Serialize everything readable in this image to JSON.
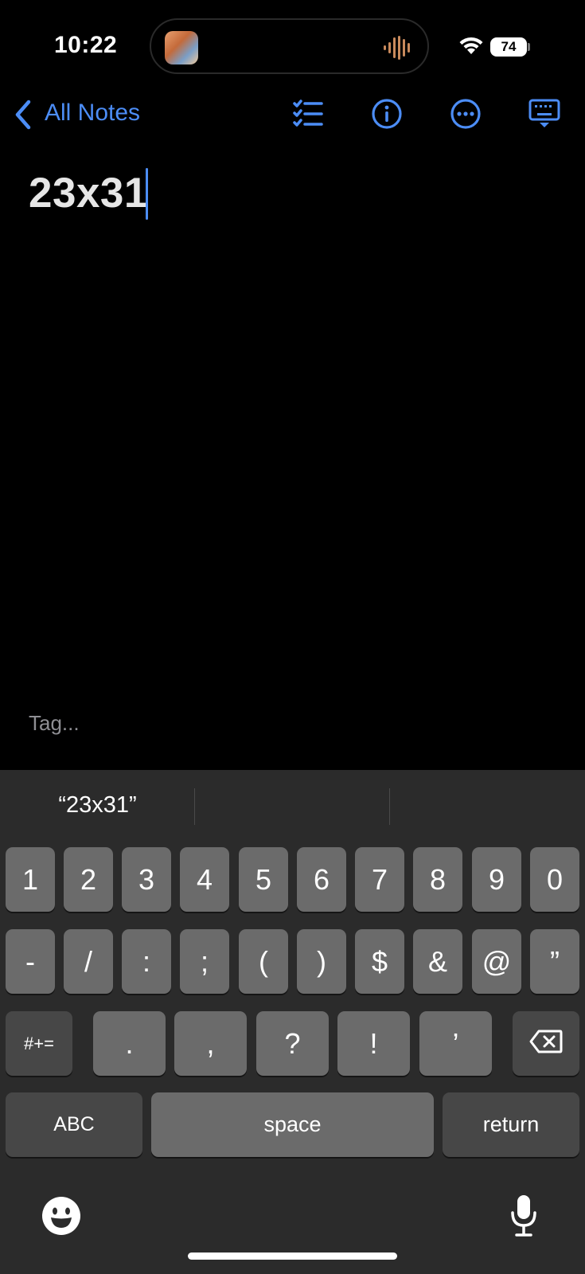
{
  "status_bar": {
    "time": "10:22",
    "battery": "74",
    "island_icon": "album-art-thumbnail",
    "island_activity_icon": "audio-waveform-icon"
  },
  "nav": {
    "back_label": "All Notes",
    "icons": [
      "checklist-icon",
      "info-icon",
      "more-icon",
      "keyboard-dismiss-icon"
    ]
  },
  "note": {
    "title": "23x31",
    "tag_placeholder": "Tag..."
  },
  "keyboard": {
    "suggestions": [
      "“23x31”",
      "",
      ""
    ],
    "row1": [
      "1",
      "2",
      "3",
      "4",
      "5",
      "6",
      "7",
      "8",
      "9",
      "0"
    ],
    "row2": [
      "-",
      "/",
      ":",
      ";",
      "(",
      ")",
      "$",
      "&",
      "@",
      "”"
    ],
    "row3": {
      "shift_label": "#+=",
      "keys": [
        ".",
        ",",
        "?",
        "!",
        "’"
      ],
      "delete_icon": "delete-backspace-icon"
    },
    "row4": {
      "abc_label": "ABC",
      "space_label": "space",
      "return_label": "return"
    },
    "bottom_icons": [
      "emoji-icon",
      "microphone-icon"
    ]
  },
  "colors": {
    "accent": "#4c8df6",
    "background": "#000000",
    "keyboard_bg": "#2b2b2b",
    "key_bg": "#6b6b6b",
    "key_dark_bg": "#474747"
  }
}
